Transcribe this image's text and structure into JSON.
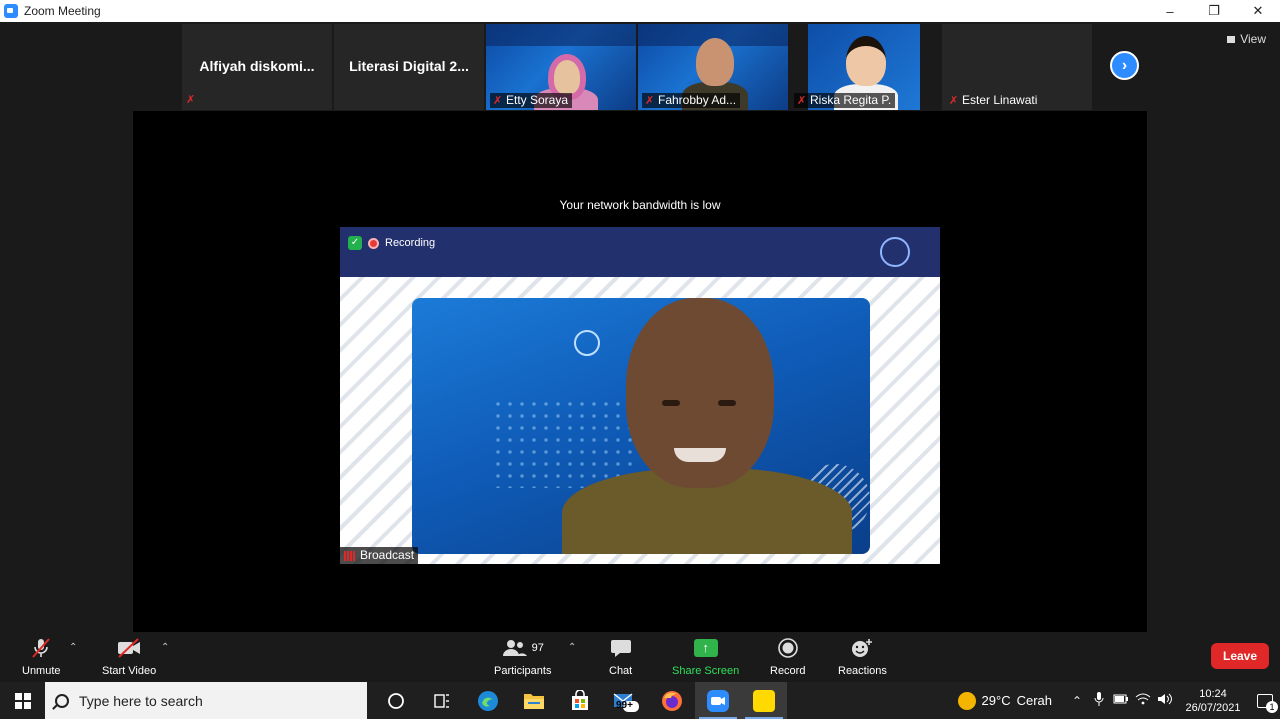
{
  "window": {
    "title": "Zoom Meeting",
    "minimize": "–",
    "restore": "❐",
    "close": "✕"
  },
  "gallery": {
    "tiles": [
      {
        "name": "Alfiyah  diskomi...",
        "muted": true,
        "video": false
      },
      {
        "name": "Literasi  Digital 2...",
        "muted": false,
        "video": false
      },
      {
        "name": "Etty Soraya",
        "muted": true,
        "video": true
      },
      {
        "name": "Fahrobby Ad...",
        "muted": true,
        "video": true
      },
      {
        "name": "Riska Regita P.",
        "muted": true,
        "video": true
      },
      {
        "name": "Ester Linawati",
        "muted": true,
        "video": false
      }
    ],
    "view_label": "View",
    "next_icon": "chevron-right-icon"
  },
  "main": {
    "notice": "Your network bandwidth is low",
    "recording_label": "Recording",
    "speaker_label": "Broadcast"
  },
  "toolbar": {
    "unmute": "Unmute",
    "start_video": "Start Video",
    "participants": "Participants",
    "participants_count": "97",
    "chat": "Chat",
    "share_screen": "Share Screen",
    "record": "Record",
    "reactions": "Reactions",
    "leave": "Leave"
  },
  "taskbar": {
    "search_placeholder": "Type here to search",
    "mail_badge": "99+",
    "weather_temp": "29°C",
    "weather_desc": "Cerah",
    "time": "10:24",
    "date": "26/07/2021",
    "notifications_count": "1"
  },
  "colors": {
    "accent_blue": "#2d8cff",
    "leave_red": "#e02828",
    "share_green": "#2fb34a"
  }
}
